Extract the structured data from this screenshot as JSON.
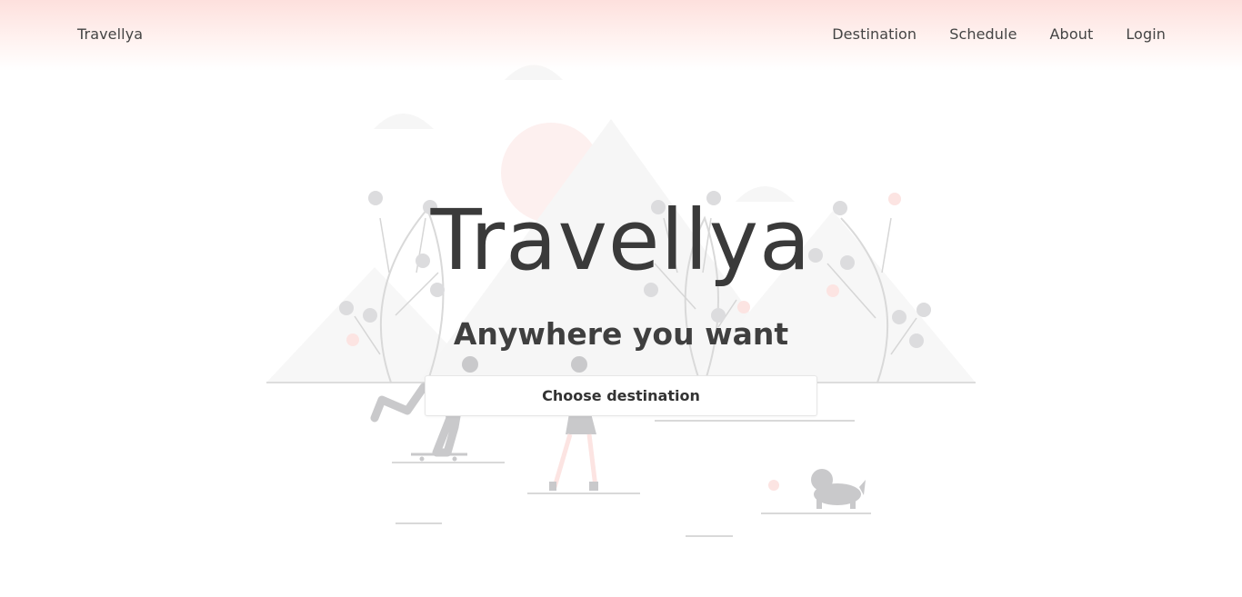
{
  "navbar": {
    "brand": "Travellya",
    "links": [
      "Destination",
      "Schedule",
      "About",
      "Login"
    ]
  },
  "hero": {
    "title": "Travellya",
    "subtitle": "Anywhere you want",
    "cta_label": "Choose destination"
  },
  "colors": {
    "nav_gradient_top": "#fde0dd",
    "illustration_gray": "#dcdcde",
    "illustration_light": "#f6f6f6",
    "accent_pink": "#fce4e2",
    "text": "#3a3a3a"
  }
}
